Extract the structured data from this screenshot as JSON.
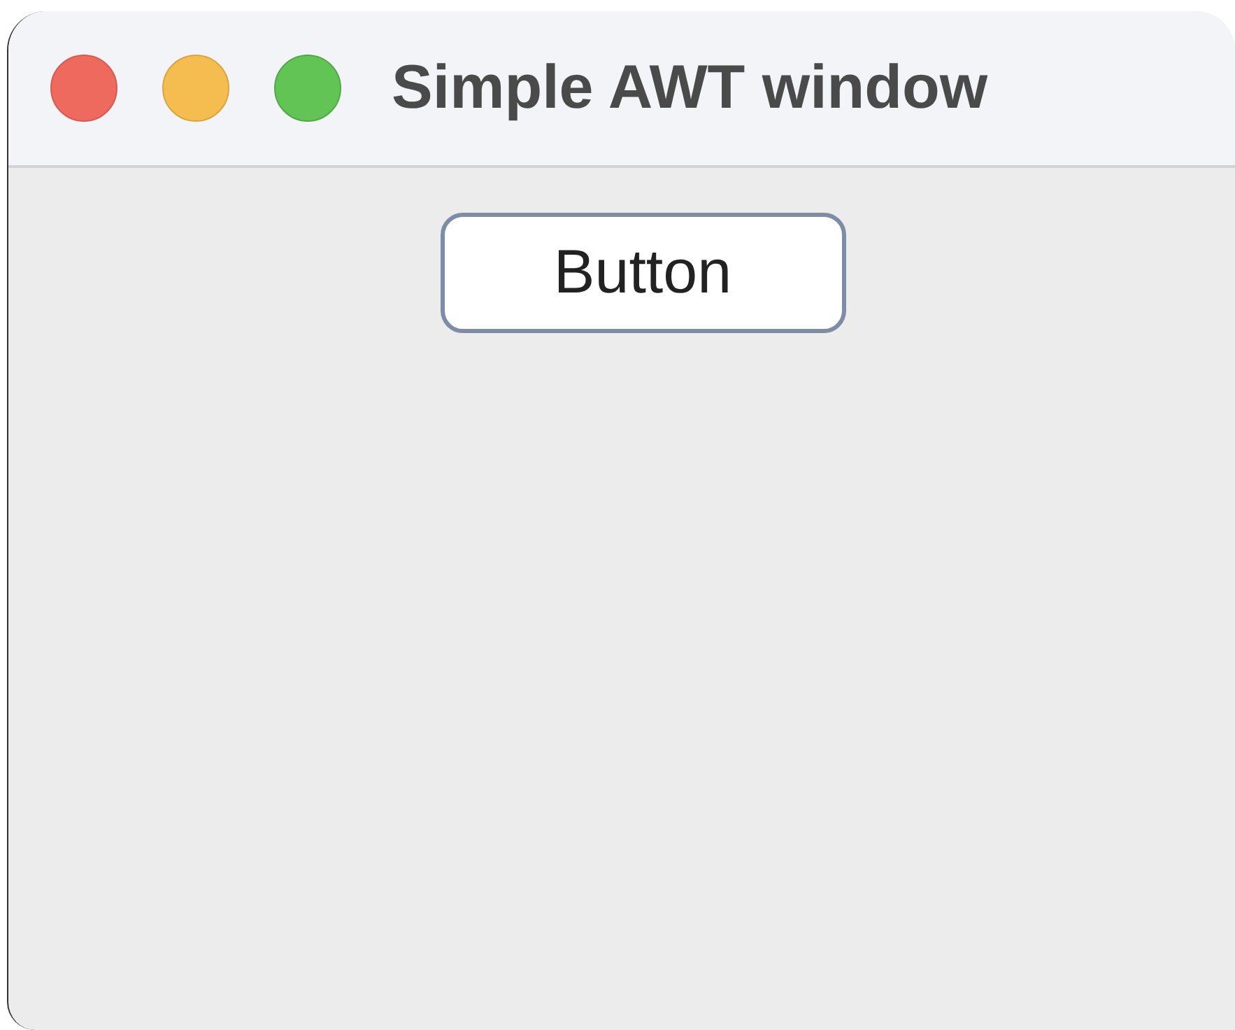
{
  "window": {
    "title": "Simple AWT window"
  },
  "button": {
    "label": "Button"
  }
}
